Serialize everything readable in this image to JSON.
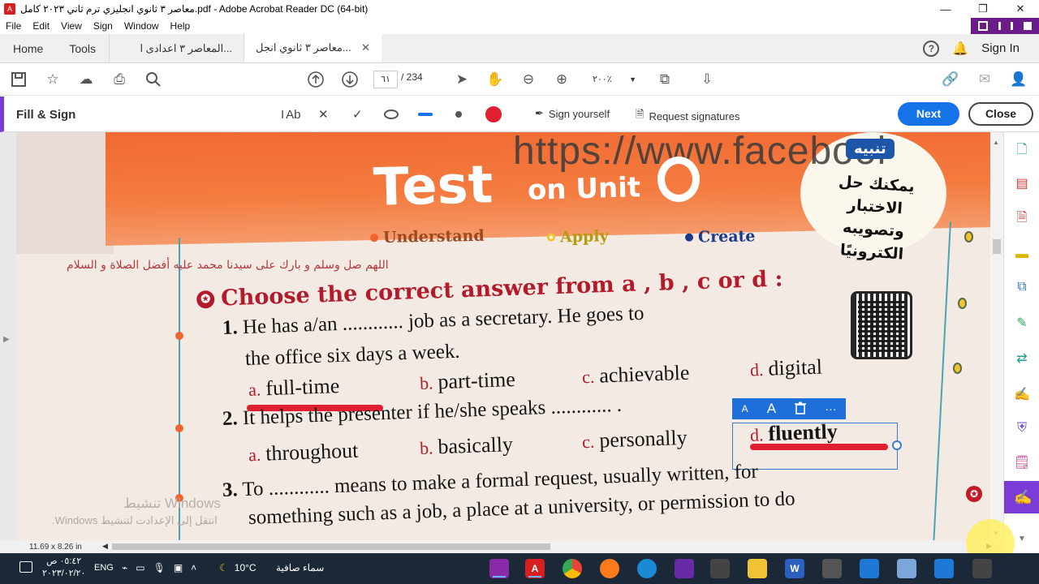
{
  "window": {
    "title": "معاصر ٣ ثانوي انجليزي ترم ثاني ٢٠٢٣ كامل.pdf - Adobe Acrobat Reader DC (64-bit)",
    "minimize": "—",
    "restore": "❐",
    "close": "✕"
  },
  "menu": [
    "File",
    "Edit",
    "View",
    "Sign",
    "Window",
    "Help"
  ],
  "tabs": {
    "home": "Home",
    "tools": "Tools",
    "doc1": "المعاصر ٣ اعدادى ا...",
    "doc2": "معاصر ٣ ثانوي انجل...",
    "sign_in": "Sign In"
  },
  "toolbar": {
    "page_current": "٦١",
    "page_total": "/ 234",
    "zoom": "٢٠٠٪"
  },
  "fill_sign": {
    "title": "Fill & Sign",
    "text_tool": "Ab",
    "sign_yourself": "Sign yourself",
    "request_signatures": "Request signatures",
    "next": "Next",
    "close": "Close",
    "accent_color": "#7a3bd6",
    "dot_color": "#e02030"
  },
  "page": {
    "url_overlay": "https://www.facebool",
    "test_title": "Test",
    "on_unit": "on Unit",
    "badge_label": "تنبيه",
    "badge_text": "يمكنك حل الاختبار وتصويبه الكترونيًا",
    "levels": [
      {
        "label": "Understand",
        "color": "#f0652e"
      },
      {
        "label": "Apply",
        "color": "#f0c52a"
      },
      {
        "label": "Create",
        "color": "#1d3a8a"
      }
    ],
    "prayer": "اللهم صل وسلم و بارك على سيدنا محمد عليه أفضل الصلاة و السلام",
    "question_header": "Choose the correct answer from a , b , c or d :",
    "q1": {
      "num": "1.",
      "line1": "He has a/an ............ job as a secretary. He goes to",
      "line2": "the office six days a week.",
      "options": [
        {
          "letter": "a.",
          "text": "full-time"
        },
        {
          "letter": "b.",
          "text": "part-time"
        },
        {
          "letter": "c.",
          "text": "achievable"
        },
        {
          "letter": "d.",
          "text": "digital"
        }
      ]
    },
    "q2": {
      "num": "2.",
      "line1": "It helps the presenter if he/she speaks ............ .",
      "options": [
        {
          "letter": "a.",
          "text": "throughout"
        },
        {
          "letter": "b.",
          "text": "basically"
        },
        {
          "letter": "c.",
          "text": "personally"
        },
        {
          "letter": "d.",
          "text": "fluently"
        }
      ]
    },
    "q3": {
      "num": "3.",
      "line1": "To ............ means to make a formal request, usually written, for",
      "line2": "something such as a job, a place at a university, or permission to do"
    },
    "field_toolbar": {
      "small_a": "A",
      "big_a": "A",
      "delete": "🗑",
      "more": "···"
    },
    "watermark_title": "تنشيط Windows",
    "watermark_sub": "انتقل إلى الإعدادت لتنشيط Windows."
  },
  "statusbar": {
    "dims": "11.69 x 8.26 in"
  },
  "taskbar": {
    "time": "٠٥:٤٢ ص",
    "date": "٢٠٢٣/٠٢/٢٠",
    "lang": "ENG",
    "temp": "10°C",
    "weather": "سماء صافية"
  }
}
